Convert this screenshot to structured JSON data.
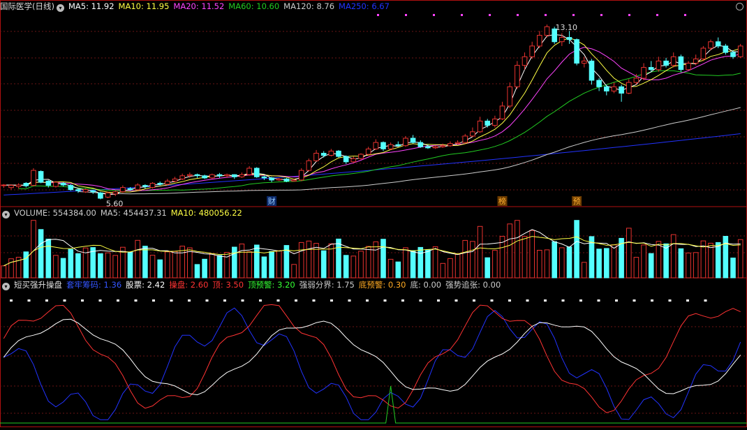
{
  "colors": {
    "bg": "#000000",
    "border": "#b01010",
    "grid": "#6a1515",
    "up": "#e8322f",
    "down": "#54ffff",
    "ma5": "#ffffff",
    "ma10": "#ffff44",
    "ma20": "#ff44ff",
    "ma60": "#22cc22",
    "ma120": "#cccccc",
    "ma250": "#2233ff"
  },
  "price_panel": {
    "title": "国际医学(日线)",
    "ma_labels": [
      {
        "key": "ma5",
        "text": "MA5: 11.92",
        "color": "#ffffff"
      },
      {
        "key": "ma10",
        "text": "MA10: 11.95",
        "color": "#ffff44"
      },
      {
        "key": "ma20",
        "text": "MA20: 11.52",
        "color": "#ff44ff"
      },
      {
        "key": "ma60",
        "text": "MA60: 10.60",
        "color": "#22cc22"
      },
      {
        "key": "ma120",
        "text": "MA120: 8.76",
        "color": "#cccccc"
      },
      {
        "key": "ma250",
        "text": "MA250: 6.67",
        "color": "#2233ff"
      }
    ],
    "high_label": "13.10",
    "low_label": "5.60",
    "events": [
      {
        "text": "财",
        "index": 36
      },
      {
        "text": "榜",
        "index": 67
      },
      {
        "text": "预",
        "index": 77
      }
    ]
  },
  "volume_panel": {
    "labels": [
      {
        "text": "VOLUME: 554384.00",
        "color": "#cccccc"
      },
      {
        "text": "MA5: 454437.31",
        "color": "#cccccc"
      },
      {
        "text": "MA10: 480056.22",
        "color": "#ffff44"
      }
    ]
  },
  "indicator_panel": {
    "title": "短买强升操盘",
    "labels": [
      {
        "text": "套牢筹码: 1.36",
        "color": "#3355ff"
      },
      {
        "text": "股票: 2.42",
        "color": "#ffffff"
      },
      {
        "text": "操盘: 2.60",
        "color": "#ff3333"
      },
      {
        "text": "顶: 3.50",
        "color": "#ff3333"
      },
      {
        "text": "顶预警: 3.20",
        "color": "#33ff33"
      },
      {
        "text": "强弱分界: 1.75",
        "color": "#cccccc"
      },
      {
        "text": "底预警: 0.30",
        "color": "#ffaa22"
      },
      {
        "text": "底: 0.00",
        "color": "#cccccc"
      },
      {
        "text": "强势追张: 0.00",
        "color": "#cccccc"
      }
    ]
  },
  "chart_data": {
    "type": "candlestick",
    "ylim": [
      5.0,
      13.4
    ],
    "candles": [
      [
        5.6,
        5.62,
        5.48,
        5.66
      ],
      [
        5.5,
        5.6,
        5.4,
        5.65
      ],
      [
        5.55,
        5.62,
        5.45,
        5.7
      ],
      [
        5.7,
        5.58,
        5.5,
        5.75
      ],
      [
        5.6,
        6.3,
        5.55,
        6.4
      ],
      [
        6.25,
        5.75,
        5.7,
        6.3
      ],
      [
        5.8,
        5.6,
        5.5,
        5.85
      ],
      [
        5.55,
        5.75,
        5.5,
        5.8
      ],
      [
        5.7,
        5.62,
        5.55,
        5.75
      ],
      [
        5.6,
        5.4,
        5.35,
        5.65
      ],
      [
        5.4,
        5.35,
        5.25,
        5.45
      ],
      [
        5.3,
        5.4,
        5.25,
        5.45
      ],
      [
        5.35,
        5.3,
        5.2,
        5.4
      ],
      [
        5.25,
        5.0,
        4.95,
        5.3
      ],
      [
        5.05,
        5.25,
        5.0,
        5.3
      ],
      [
        5.2,
        5.3,
        5.1,
        5.35
      ],
      [
        5.3,
        5.5,
        5.25,
        5.6
      ],
      [
        5.45,
        5.4,
        5.35,
        5.52
      ],
      [
        5.4,
        5.62,
        5.35,
        5.7
      ],
      [
        5.6,
        5.55,
        5.45,
        5.65
      ],
      [
        5.5,
        5.7,
        5.45,
        5.75
      ],
      [
        5.7,
        5.65,
        5.6,
        5.78
      ],
      [
        5.65,
        5.8,
        5.6,
        5.9
      ],
      [
        5.8,
        5.9,
        5.75,
        6.0
      ],
      [
        5.9,
        6.05,
        5.85,
        6.15
      ],
      [
        6.05,
        6.1,
        5.95,
        6.2
      ],
      [
        6.1,
        6.05,
        5.95,
        6.15
      ],
      [
        6.05,
        5.95,
        5.9,
        6.1
      ],
      [
        5.95,
        6.1,
        5.9,
        6.15
      ],
      [
        6.1,
        6.05,
        5.95,
        6.18
      ],
      [
        6.05,
        6.1,
        5.95,
        6.15
      ],
      [
        6.1,
        6.0,
        5.9,
        6.12
      ],
      [
        6.0,
        6.1,
        5.95,
        6.2
      ],
      [
        6.1,
        6.4,
        6.05,
        6.5
      ],
      [
        6.4,
        6.0,
        5.95,
        6.45
      ],
      [
        6.0,
        5.95,
        5.85,
        6.05
      ],
      [
        5.95,
        5.85,
        5.75,
        6.0
      ],
      [
        5.85,
        5.9,
        5.8,
        5.95
      ],
      [
        5.9,
        5.8,
        5.75,
        5.95
      ],
      [
        5.8,
        5.85,
        5.78,
        5.9
      ],
      [
        5.85,
        6.3,
        5.8,
        6.4
      ],
      [
        6.3,
        6.75,
        6.25,
        6.85
      ],
      [
        6.75,
        7.1,
        6.7,
        7.25
      ],
      [
        7.1,
        7.0,
        6.9,
        7.2
      ],
      [
        7.0,
        7.2,
        6.95,
        7.3
      ],
      [
        7.2,
        6.95,
        6.9,
        7.25
      ],
      [
        6.95,
        6.7,
        6.6,
        7.0
      ],
      [
        6.7,
        6.85,
        6.65,
        6.95
      ],
      [
        6.85,
        7.05,
        6.8,
        7.1
      ],
      [
        7.05,
        7.3,
        7.0,
        7.4
      ],
      [
        7.3,
        7.6,
        7.25,
        7.75
      ],
      [
        7.6,
        7.3,
        7.2,
        7.65
      ],
      [
        7.3,
        7.5,
        7.25,
        7.6
      ],
      [
        7.5,
        7.45,
        7.4,
        7.65
      ],
      [
        7.45,
        7.8,
        7.4,
        7.9
      ],
      [
        7.8,
        7.6,
        7.55,
        7.95
      ],
      [
        7.6,
        7.4,
        7.35,
        7.7
      ],
      [
        7.4,
        7.35,
        7.3,
        7.5
      ],
      [
        7.35,
        7.4,
        7.3,
        7.45
      ],
      [
        7.4,
        7.45,
        7.35,
        7.55
      ],
      [
        7.45,
        7.55,
        7.4,
        7.65
      ],
      [
        7.55,
        7.6,
        7.5,
        7.7
      ],
      [
        7.6,
        7.9,
        7.55,
        8.0
      ],
      [
        7.9,
        8.1,
        7.85,
        8.3
      ],
      [
        8.1,
        8.6,
        8.05,
        8.8
      ],
      [
        8.6,
        8.4,
        8.3,
        8.7
      ],
      [
        8.4,
        8.7,
        8.3,
        8.85
      ],
      [
        8.7,
        9.3,
        8.65,
        9.5
      ],
      [
        9.3,
        10.2,
        9.2,
        10.4
      ],
      [
        10.2,
        11.2,
        10.1,
        11.4
      ],
      [
        11.2,
        11.6,
        11.0,
        11.8
      ],
      [
        11.6,
        12.1,
        11.5,
        12.3
      ],
      [
        12.1,
        12.6,
        12.0,
        12.8
      ],
      [
        12.6,
        13.0,
        12.5,
        13.1
      ],
      [
        12.9,
        12.3,
        12.2,
        13.0
      ],
      [
        12.3,
        12.5,
        12.1,
        12.7
      ],
      [
        12.5,
        12.4,
        12.2,
        12.8
      ],
      [
        12.4,
        11.3,
        11.2,
        12.45
      ],
      [
        11.3,
        11.4,
        11.1,
        11.6
      ],
      [
        11.4,
        10.5,
        10.3,
        11.5
      ],
      [
        10.5,
        10.2,
        10.0,
        10.6
      ],
      [
        10.2,
        10.0,
        9.8,
        10.3
      ],
      [
        10.0,
        10.2,
        9.9,
        10.4
      ],
      [
        10.2,
        9.9,
        9.5,
        10.3
      ],
      [
        9.9,
        10.4,
        9.85,
        10.55
      ],
      [
        10.4,
        10.6,
        10.3,
        10.8
      ],
      [
        10.6,
        11.1,
        10.5,
        11.3
      ],
      [
        11.1,
        11.0,
        10.9,
        11.4
      ],
      [
        11.0,
        11.4,
        10.9,
        11.6
      ],
      [
        11.4,
        11.2,
        11.1,
        11.55
      ],
      [
        11.2,
        11.6,
        11.1,
        11.8
      ],
      [
        11.6,
        11.0,
        10.9,
        11.7
      ],
      [
        11.0,
        11.3,
        10.95,
        11.4
      ],
      [
        11.3,
        11.5,
        11.2,
        11.7
      ],
      [
        11.5,
        12.0,
        11.4,
        12.1
      ],
      [
        12.0,
        12.3,
        11.9,
        12.4
      ],
      [
        12.3,
        12.1,
        12.0,
        12.5
      ],
      [
        12.1,
        11.8,
        11.7,
        12.2
      ],
      [
        11.8,
        11.6,
        11.5,
        11.9
      ],
      [
        11.6,
        12.1,
        11.55,
        12.2
      ]
    ],
    "volume": {
      "max": 850000,
      "ma5": 454437.31,
      "ma10": 480056.22,
      "last": 554384.0
    },
    "indicator": {
      "ylim": [
        0,
        3.8
      ],
      "top": 3.5,
      "top_warn": 3.2,
      "divide": 1.75,
      "bottom_warn": 0.3,
      "bottom": 0.0
    }
  }
}
